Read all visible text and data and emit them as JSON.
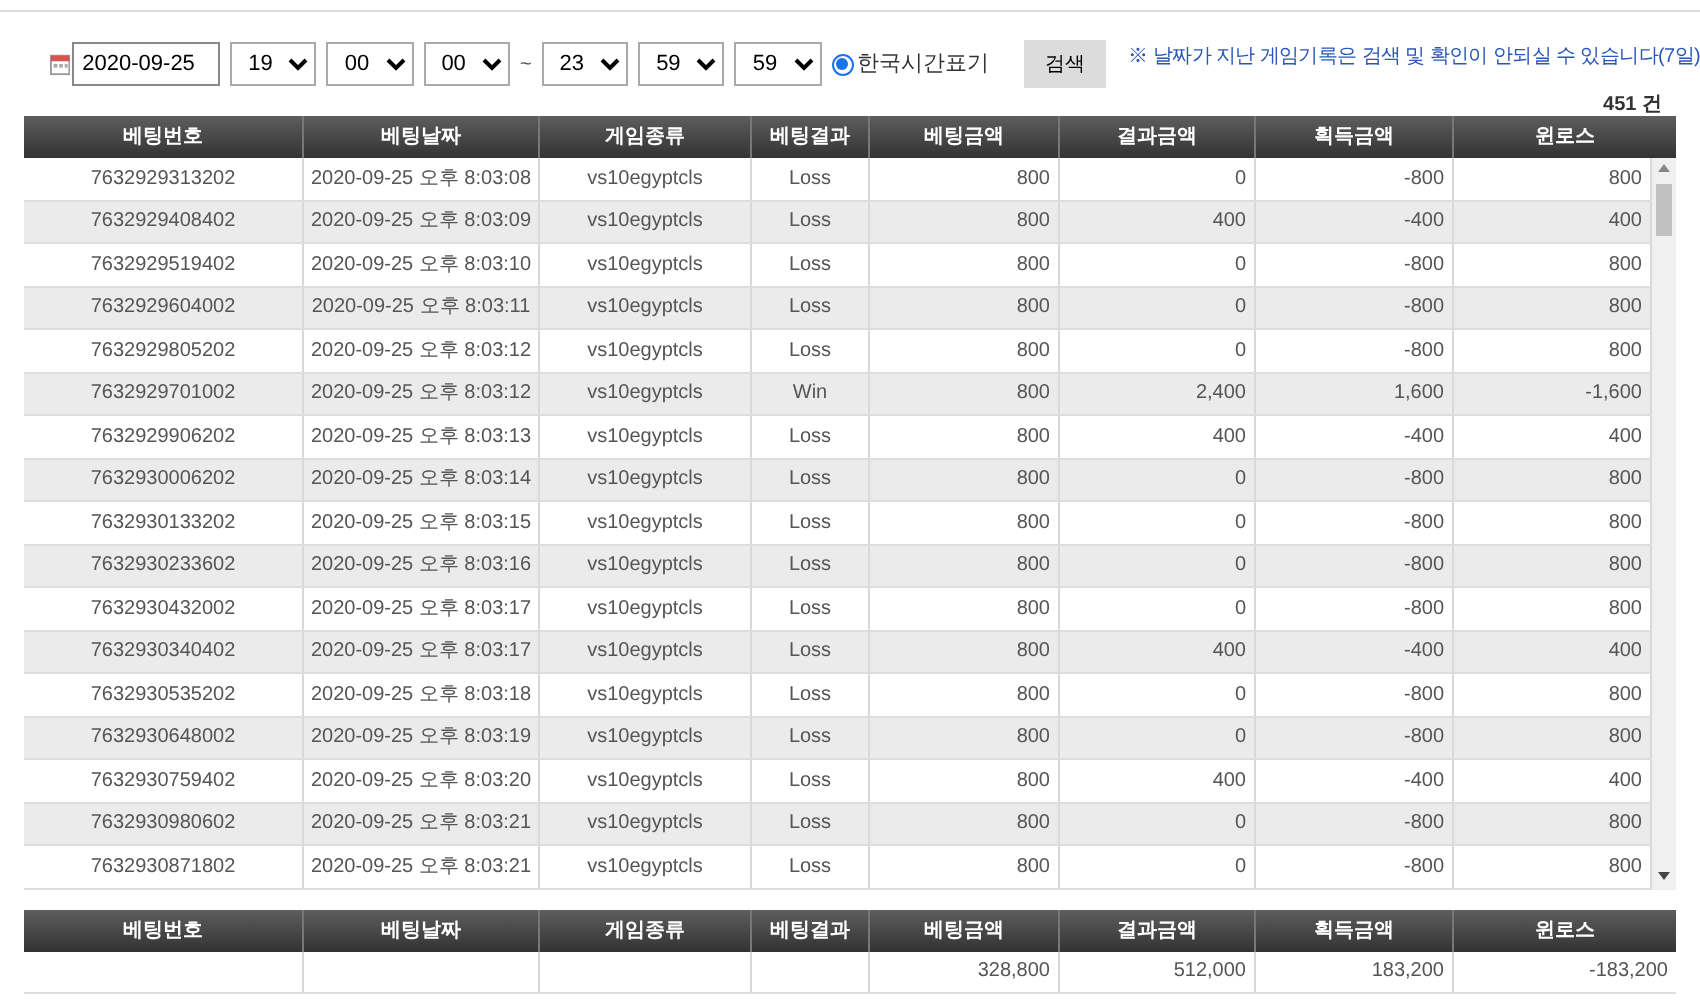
{
  "filter": {
    "date": "2020-09-25",
    "start": [
      "19",
      "00",
      "00"
    ],
    "separator": "~",
    "end": [
      "23",
      "59",
      "59"
    ],
    "timezone": {
      "label": "한국시간표기",
      "checked": true
    },
    "search_button": "검색",
    "notice": "※ 날짜가 지난 게임기록은 검색 및 확인이 안되실 수 있습니다(7일)"
  },
  "count": "451 건",
  "table": {
    "columns": [
      "베팅번호",
      "베팅날짜",
      "게임종류",
      "베팅결과",
      "베팅금액",
      "결과금액",
      "획득금액",
      "윈로스"
    ],
    "rows": [
      [
        "7632929313202",
        "2020-09-25 오후 8:03:08",
        "vs10egyptcls",
        "Loss",
        "800",
        "0",
        "-800",
        "800"
      ],
      [
        "7632929408402",
        "2020-09-25 오후 8:03:09",
        "vs10egyptcls",
        "Loss",
        "800",
        "400",
        "-400",
        "400"
      ],
      [
        "7632929519402",
        "2020-09-25 오후 8:03:10",
        "vs10egyptcls",
        "Loss",
        "800",
        "0",
        "-800",
        "800"
      ],
      [
        "7632929604002",
        "2020-09-25 오후 8:03:11",
        "vs10egyptcls",
        "Loss",
        "800",
        "0",
        "-800",
        "800"
      ],
      [
        "7632929805202",
        "2020-09-25 오후 8:03:12",
        "vs10egyptcls",
        "Loss",
        "800",
        "0",
        "-800",
        "800"
      ],
      [
        "7632929701002",
        "2020-09-25 오후 8:03:12",
        "vs10egyptcls",
        "Win",
        "800",
        "2,400",
        "1,600",
        "-1,600"
      ],
      [
        "7632929906202",
        "2020-09-25 오후 8:03:13",
        "vs10egyptcls",
        "Loss",
        "800",
        "400",
        "-400",
        "400"
      ],
      [
        "7632930006202",
        "2020-09-25 오후 8:03:14",
        "vs10egyptcls",
        "Loss",
        "800",
        "0",
        "-800",
        "800"
      ],
      [
        "7632930133202",
        "2020-09-25 오후 8:03:15",
        "vs10egyptcls",
        "Loss",
        "800",
        "0",
        "-800",
        "800"
      ],
      [
        "7632930233602",
        "2020-09-25 오후 8:03:16",
        "vs10egyptcls",
        "Loss",
        "800",
        "0",
        "-800",
        "800"
      ],
      [
        "7632930432002",
        "2020-09-25 오후 8:03:17",
        "vs10egyptcls",
        "Loss",
        "800",
        "0",
        "-800",
        "800"
      ],
      [
        "7632930340402",
        "2020-09-25 오후 8:03:17",
        "vs10egyptcls",
        "Loss",
        "800",
        "400",
        "-400",
        "400"
      ],
      [
        "7632930535202",
        "2020-09-25 오후 8:03:18",
        "vs10egyptcls",
        "Loss",
        "800",
        "0",
        "-800",
        "800"
      ],
      [
        "7632930648002",
        "2020-09-25 오후 8:03:19",
        "vs10egyptcls",
        "Loss",
        "800",
        "0",
        "-800",
        "800"
      ],
      [
        "7632930759402",
        "2020-09-25 오후 8:03:20",
        "vs10egyptcls",
        "Loss",
        "800",
        "400",
        "-400",
        "400"
      ],
      [
        "7632930980602",
        "2020-09-25 오후 8:03:21",
        "vs10egyptcls",
        "Loss",
        "800",
        "0",
        "-800",
        "800"
      ],
      [
        "7632930871802",
        "2020-09-25 오후 8:03:21",
        "vs10egyptcls",
        "Loss",
        "800",
        "0",
        "-800",
        "800"
      ]
    ]
  },
  "summary": {
    "columns": [
      "베팅번호",
      "베팅날짜",
      "게임종류",
      "베팅결과",
      "베팅금액",
      "결과금액",
      "획득금액",
      "윈로스"
    ],
    "totals": [
      "328,800",
      "512,000",
      "183,200",
      "-183,200"
    ]
  }
}
